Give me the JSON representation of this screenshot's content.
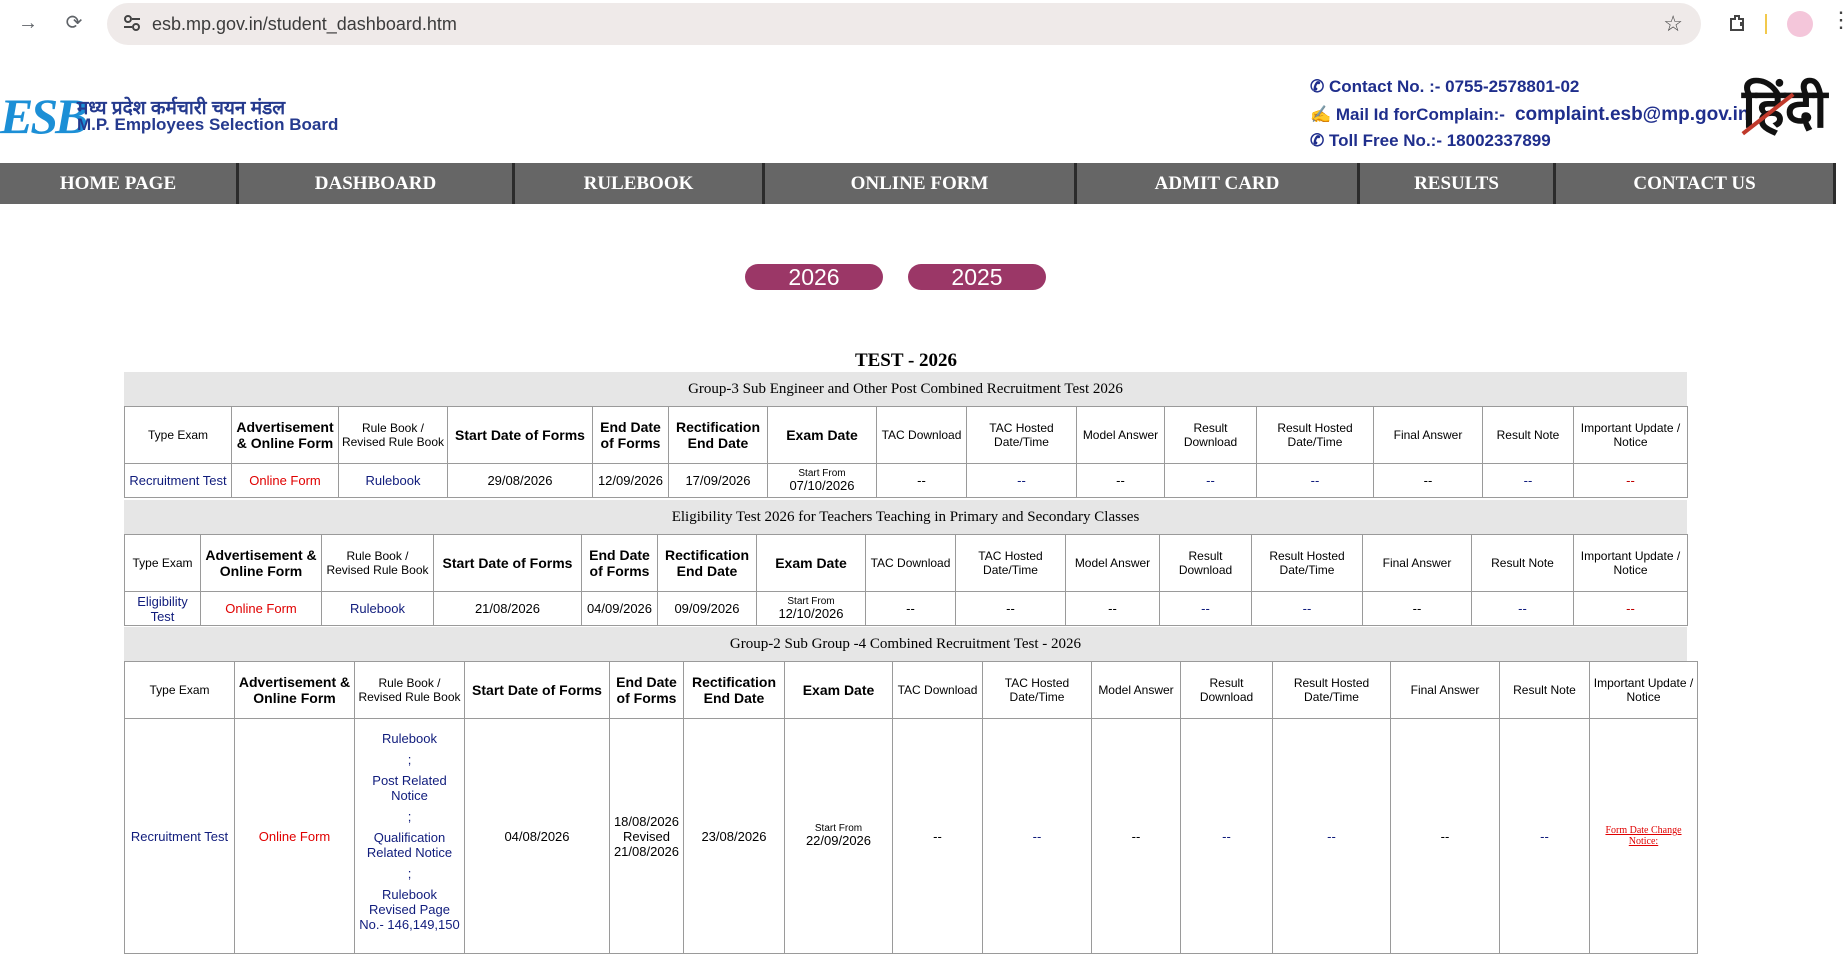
{
  "browser": {
    "url": "esb.mp.gov.in/student_dashboard.htm"
  },
  "header": {
    "logo_mark": "ESB",
    "logo_hindi": "मध्य प्रदेश कर्मचारी चयन मंडल",
    "logo_english": "M.P. Employees Selection Board",
    "contact_label": "Contact No. :- 0755-2578801-02",
    "mail_label": "Mail Id forComplain:-",
    "mail_value": "complaint.esb@mp.gov.in",
    "tollfree_label": "Toll Free No.:- 18002337899",
    "hindi_button": "हिंदी"
  },
  "nav": [
    {
      "label": "HOME PAGE"
    },
    {
      "label": "DASHBOARD"
    },
    {
      "label": "RULEBOOK"
    },
    {
      "label": "ONLINE FORM"
    },
    {
      "label": "ADMIT CARD"
    },
    {
      "label": "RESULTS"
    },
    {
      "label": "CONTACT US"
    }
  ],
  "years": [
    "2026",
    "2025"
  ],
  "section_title": "TEST - 2026",
  "columns": {
    "type_exam": "Type Exam",
    "advertisement": "Advertisement & Online Form",
    "rulebook": "Rule Book / Revised Rule Book",
    "start_date": "Start Date of Forms",
    "end_date": "End Date of Forms",
    "rectification": "Rectification End Date",
    "exam_date": "Exam Date",
    "tac_download": "TAC Download",
    "tac_hosted": "TAC Hosted Date/Time",
    "model_answer": "Model Answer",
    "result_download": "Result Download",
    "result_hosted": "Result Hosted Date/Time",
    "final_answer": "Final Answer",
    "result_note": "Result Note",
    "important_update": "Important Update / Notice"
  },
  "groups": [
    {
      "title": "Group-3 Sub Engineer and Other Post Combined Recruitment Test 2026",
      "type_exam": "Recruitment Test",
      "online_form": "Online Form",
      "rulebook": "Rulebook",
      "start_date": "29/08/2026",
      "end_date": "12/09/2026",
      "rectification": "17/09/2026",
      "exam_prefix": "Start From",
      "exam_date": "07/10/2026",
      "tac_download": "--",
      "tac_hosted": "--",
      "model_answer": "--",
      "result_download": "--",
      "result_hosted": "--",
      "final_answer": "--",
      "result_note": "--",
      "important_update": "--"
    },
    {
      "title": "Eligibility Test 2026 for Teachers Teaching in Primary and Secondary Classes",
      "type_exam": "Eligibility Test",
      "online_form": "Online Form",
      "rulebook": "Rulebook",
      "start_date": "21/08/2026",
      "end_date": "04/09/2026",
      "rectification": "09/09/2026",
      "exam_prefix": "Start From",
      "exam_date": "12/10/2026",
      "tac_download": "--",
      "tac_hosted": "--",
      "model_answer": "--",
      "result_download": "--",
      "result_hosted": "--",
      "final_answer": "--",
      "result_note": "--",
      "important_update": "--"
    },
    {
      "title": "Group-2 Sub Group -4  Combined Recruitment Test - 2026",
      "type_exam": "Recruitment Test",
      "online_form": "Online Form",
      "rulebook_links": [
        "Rulebook",
        "Post Related Notice",
        "Qualification Related Notice",
        "Rulebook Revised Page No.- 146,149,150"
      ],
      "separator": ";",
      "start_date": "04/08/2026",
      "end_date_lines": [
        "18/08/2026",
        "Revised",
        "21/08/2026"
      ],
      "rectification": "23/08/2026",
      "exam_prefix": "Start From",
      "exam_date": "22/09/2026",
      "tac_download": "--",
      "tac_hosted": "--",
      "model_answer": "--",
      "result_download": "--",
      "result_hosted": "--",
      "final_answer": "--",
      "result_note": "--",
      "important_update": "Form Date Change Notice:"
    }
  ]
}
